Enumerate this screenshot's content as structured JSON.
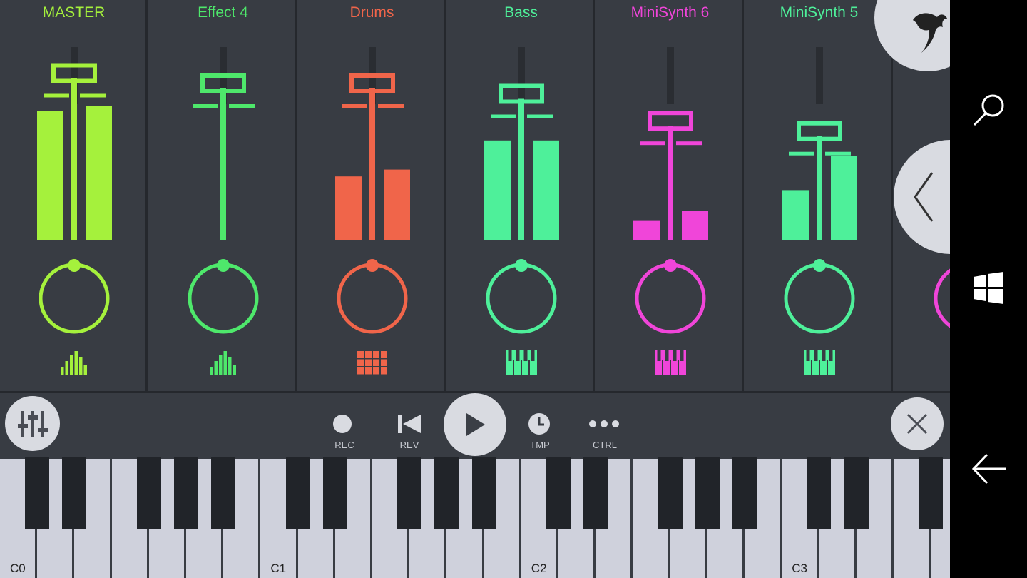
{
  "channels": [
    {
      "name": "MASTER",
      "color": "#a5f13c",
      "fader": 0.85,
      "meter_l": 0.75,
      "meter_r": 0.78,
      "icon": "meter-icon"
    },
    {
      "name": "Effect 4",
      "color": "#4ee86b",
      "fader": 0.8,
      "meter_l": 0.0,
      "meter_r": 0.0,
      "icon": "meter-icon"
    },
    {
      "name": "Drums",
      "color": "#f0654a",
      "fader": 0.8,
      "meter_l": 0.37,
      "meter_r": 0.41,
      "icon": "drum-pads-icon"
    },
    {
      "name": "Bass",
      "color": "#4ef09a",
      "fader": 0.75,
      "meter_l": 0.58,
      "meter_r": 0.58,
      "icon": "piano-icon"
    },
    {
      "name": "MiniSynth 6",
      "color": "#f045d9",
      "fader": 0.62,
      "meter_l": 0.11,
      "meter_r": 0.17,
      "icon": "piano-icon"
    },
    {
      "name": "MiniSynth 5",
      "color": "#4ef09a",
      "fader": 0.57,
      "meter_l": 0.29,
      "meter_r": 0.49,
      "icon": "piano-icon"
    }
  ],
  "transport": {
    "rec_label": "REC",
    "rev_label": "REV",
    "tmp_label": "TMP",
    "ctrl_label": "CTRL"
  },
  "keyboard": {
    "labels": [
      "C0",
      "C1",
      "C2",
      "C3"
    ]
  },
  "colors": {
    "background": "#383c43",
    "button": "#d9dbe1",
    "icon": "#4a4d55"
  },
  "icons": {
    "mixer": "mixer-sliders-icon",
    "close": "close-icon",
    "logo": "fl-studio-logo-icon",
    "back": "chevron-left-icon",
    "search": "search-icon",
    "windows": "windows-icon",
    "nav_back": "arrow-left-icon"
  }
}
